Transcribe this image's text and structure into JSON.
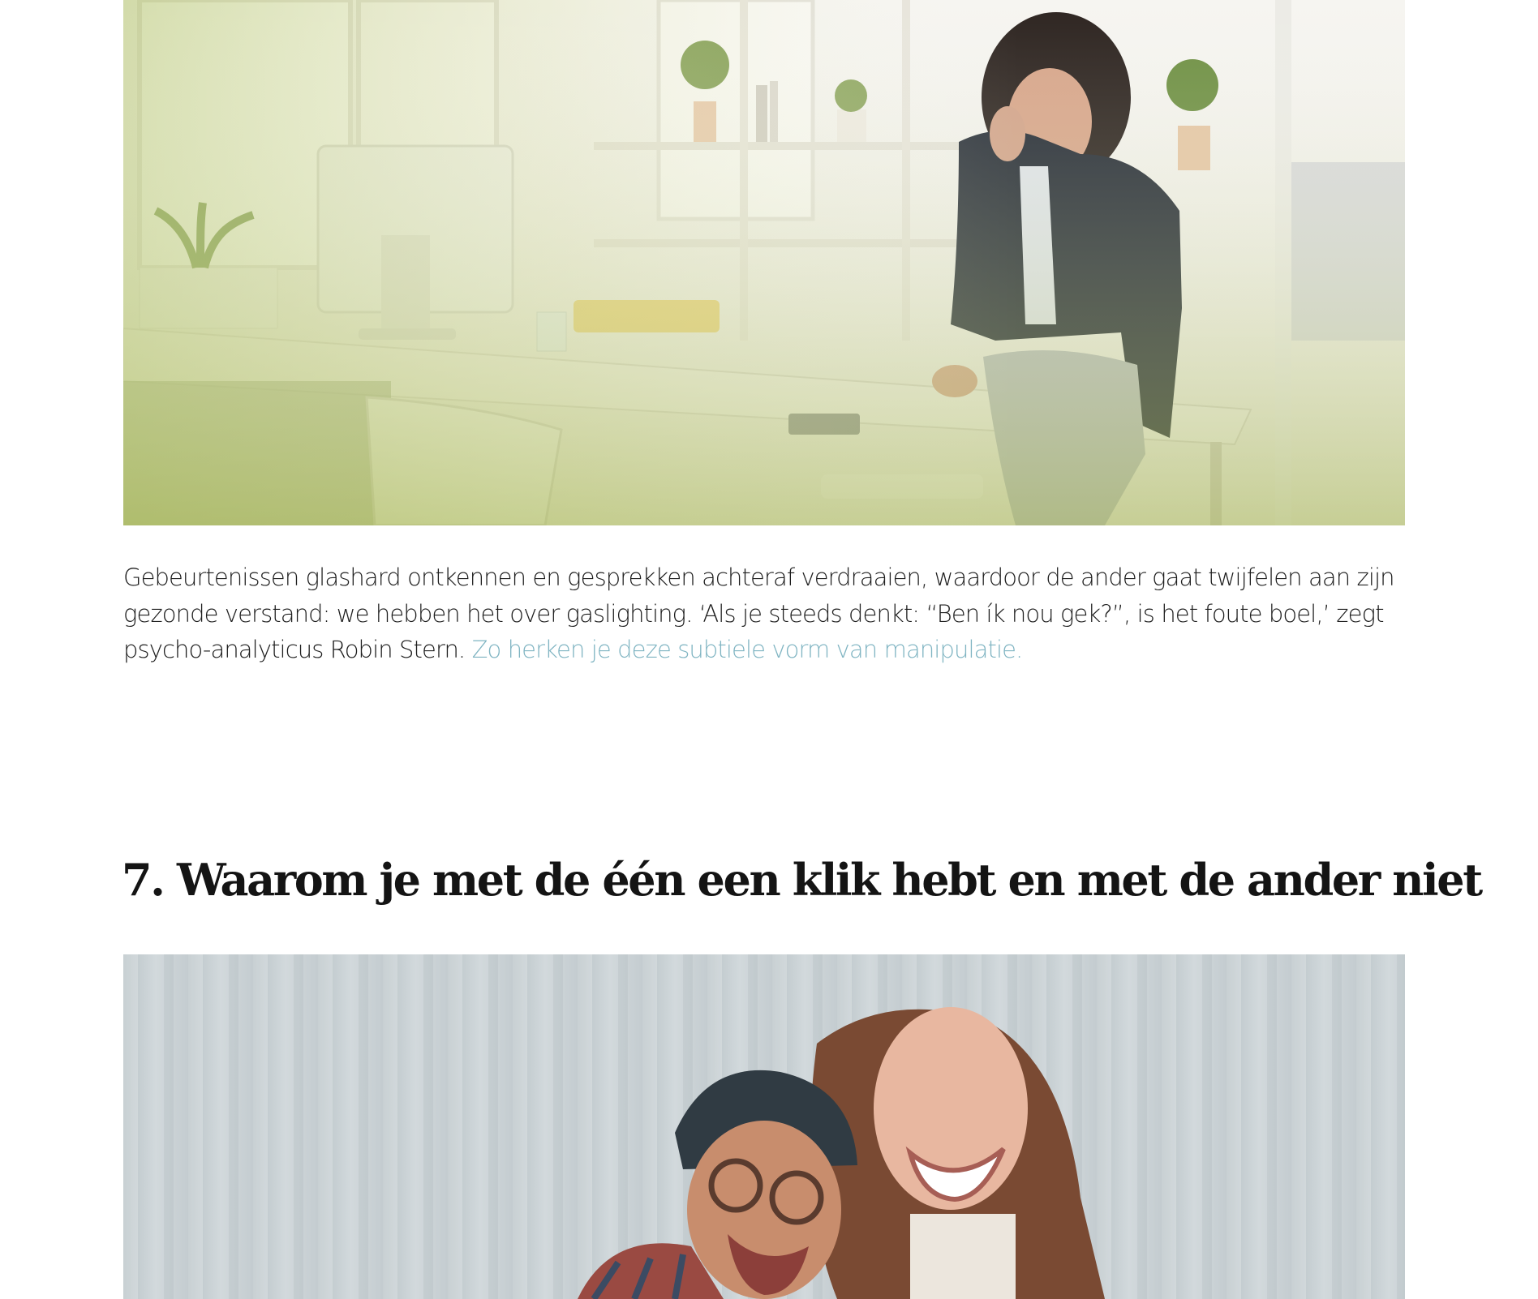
{
  "article": {
    "images": [
      {
        "name": "woman-at-office-desk",
        "alt": ""
      },
      {
        "name": "laughing-couple",
        "alt": ""
      }
    ],
    "paragraph": {
      "text": "Gebeurtenissen glashard ontkennen en gesprekken achteraf verdraaien, waardoor de ander gaat twijfelen aan zijn gezonde verstand: we hebben het over gaslighting. ‘Als je steeds denkt: “Ben ík nou gek?”, is het foute boel,’ zegt psycho-analyticus Robin Stern. ",
      "link_text": "Zo herken je deze subtiele vorm van manipulatie."
    },
    "section_heading": "7. Waarom je met de één een klik hebt en met de ander niet"
  },
  "colors": {
    "link": "#7fb4c2",
    "text": "#1e1e1e",
    "heading": "#141414",
    "background": "#ffffff"
  }
}
